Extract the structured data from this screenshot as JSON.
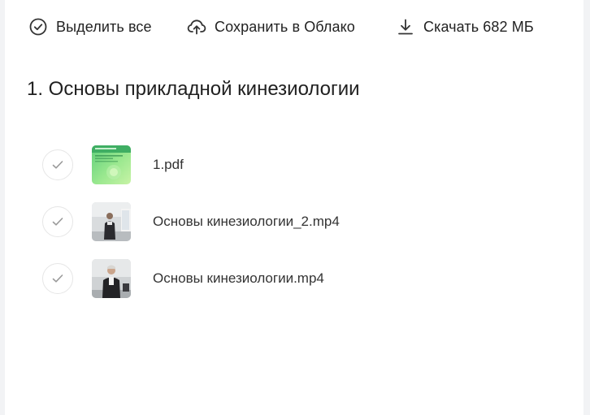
{
  "toolbar": {
    "select_all_label": "Выделить все",
    "save_cloud_label": "Сохранить в Облако",
    "download_label": "Скачать 682 МБ"
  },
  "folder": {
    "title": "1. Основы прикладной кинезиологии"
  },
  "files": [
    {
      "name": "1.pdf",
      "thumb": "pdf-cover-thumbnail"
    },
    {
      "name": "Основы кинезиологии_2.mp4",
      "thumb": "video-thumbnail"
    },
    {
      "name": "Основы кинезиологии.mp4",
      "thumb": "video-thumbnail"
    }
  ],
  "colors": {
    "icon": "#333333",
    "check": "#9a9a9a",
    "check_border": "#e6e6e6",
    "pdf_green": "#7fdc8a"
  }
}
